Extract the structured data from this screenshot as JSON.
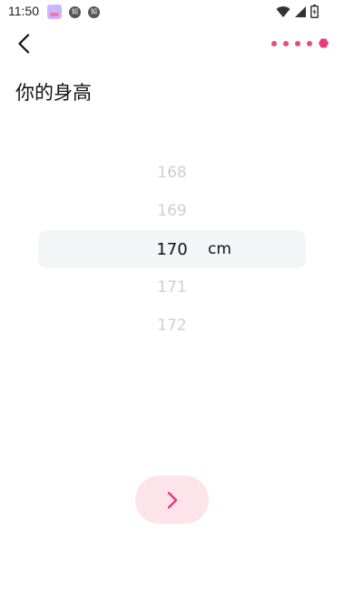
{
  "status_bar": {
    "time": "11:50",
    "left_icons": [
      "app-icon",
      "zhihu-icon",
      "zhihu-icon"
    ],
    "right_icons": [
      "wifi-icon",
      "signal-icon",
      "battery-icon"
    ]
  },
  "header": {
    "back_icon": "chevron-left-icon",
    "progress": {
      "total_steps": 5,
      "current_step": 5
    }
  },
  "title": "你的身高",
  "picker": {
    "options": [
      "168",
      "169",
      "170",
      "171",
      "172"
    ],
    "selected": "170",
    "unit": "cm"
  },
  "next_button": {
    "icon": "chevron-right-icon"
  },
  "colors": {
    "accent": "#e93a7a",
    "next_bg": "#fde3ea",
    "highlight": "#f4f5f7",
    "faded_text": "#cfcfcf"
  }
}
